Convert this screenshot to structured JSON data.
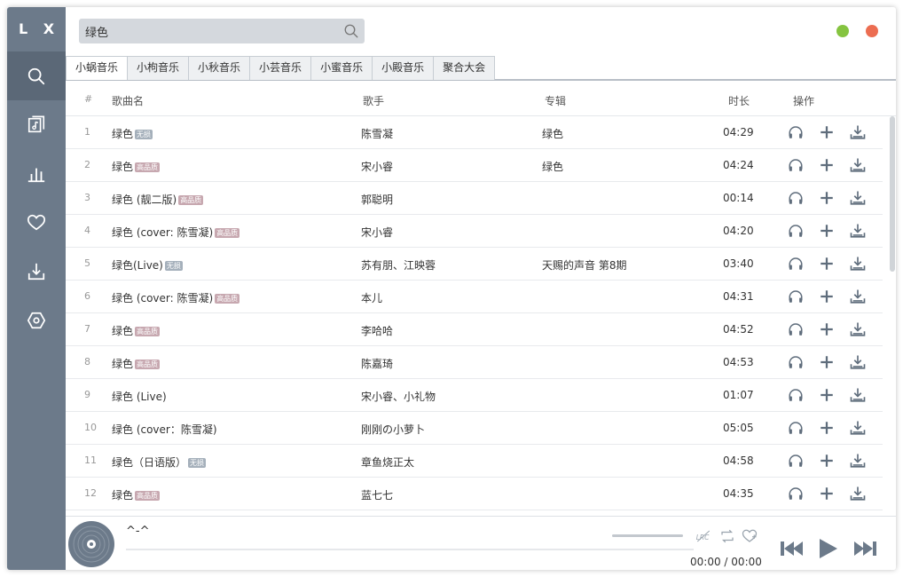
{
  "app": {
    "logo": "L X"
  },
  "sidebar": {
    "items": [
      {
        "name": "search",
        "active": true
      },
      {
        "name": "songlist",
        "active": false
      },
      {
        "name": "leaderboard",
        "active": false
      },
      {
        "name": "favorite",
        "active": false
      },
      {
        "name": "download",
        "active": false
      },
      {
        "name": "settings",
        "active": false
      }
    ]
  },
  "search": {
    "value": "绿色"
  },
  "tabs": [
    "小蜗音乐",
    "小枸音乐",
    "小秋音乐",
    "小芸音乐",
    "小蜜音乐",
    "小殿音乐",
    "聚合大会"
  ],
  "table": {
    "headers": {
      "index": "#",
      "name": "歌曲名",
      "singer": "歌手",
      "album": "专辑",
      "duration": "时长",
      "ops": "操作"
    },
    "rows": [
      {
        "index": "1",
        "name": "绿色",
        "badge": "无损",
        "badge_type": "plain",
        "singer": "陈雪凝",
        "album": "绿色",
        "duration": "04:29"
      },
      {
        "index": "2",
        "name": "绿色",
        "badge": "高品质",
        "badge_type": "hq",
        "singer": "宋小睿",
        "album": "绿色",
        "duration": "04:24"
      },
      {
        "index": "3",
        "name": "绿色 (靓二版)",
        "badge": "高品质",
        "badge_type": "hq",
        "singer": "郭聪明",
        "album": "",
        "duration": "00:14"
      },
      {
        "index": "4",
        "name": "绿色 (cover: 陈雪凝)",
        "badge": "高品质",
        "badge_type": "hq",
        "singer": "宋小睿",
        "album": "",
        "duration": "04:20"
      },
      {
        "index": "5",
        "name": "绿色(Live)",
        "badge": "无损",
        "badge_type": "plain",
        "singer": "苏有朋、江映蓉",
        "album": "天赐的声音 第8期",
        "duration": "03:40"
      },
      {
        "index": "6",
        "name": "绿色 (cover: 陈雪凝)",
        "badge": "高品质",
        "badge_type": "hq",
        "singer": "本儿",
        "album": "",
        "duration": "04:31"
      },
      {
        "index": "7",
        "name": "绿色",
        "badge": "高品质",
        "badge_type": "hq",
        "singer": "李哈哈",
        "album": "",
        "duration": "04:52"
      },
      {
        "index": "8",
        "name": "绿色",
        "badge": "高品质",
        "badge_type": "hq",
        "singer": "陈嘉琦",
        "album": "",
        "duration": "04:53"
      },
      {
        "index": "9",
        "name": "绿色 (Live)",
        "badge": "",
        "badge_type": "",
        "singer": "宋小睿、小礼物",
        "album": "",
        "duration": "01:07"
      },
      {
        "index": "10",
        "name": "绿色 (cover：陈雪凝)",
        "badge": "",
        "badge_type": "",
        "singer": "刚刚の小萝卜",
        "album": "",
        "duration": "05:05"
      },
      {
        "index": "11",
        "name": "绿色（日语版）",
        "badge": "无损",
        "badge_type": "plain",
        "singer": "章鱼烧正太",
        "album": "",
        "duration": "04:58"
      },
      {
        "index": "12",
        "name": "绿色",
        "badge": "高品质",
        "badge_type": "hq",
        "singer": "蓝七七",
        "album": "",
        "duration": "04:35"
      }
    ]
  },
  "player": {
    "title": "^-^",
    "lrc_label": "LRC",
    "current_time": "00:00",
    "separator": "/",
    "total_time": "00:00"
  },
  "colors": {
    "sidebar": "#6c7a8a",
    "sidebar_active": "#5b6877",
    "minimize": "#85c440",
    "close": "#ec6d51",
    "icon": "#5f6d7c"
  }
}
